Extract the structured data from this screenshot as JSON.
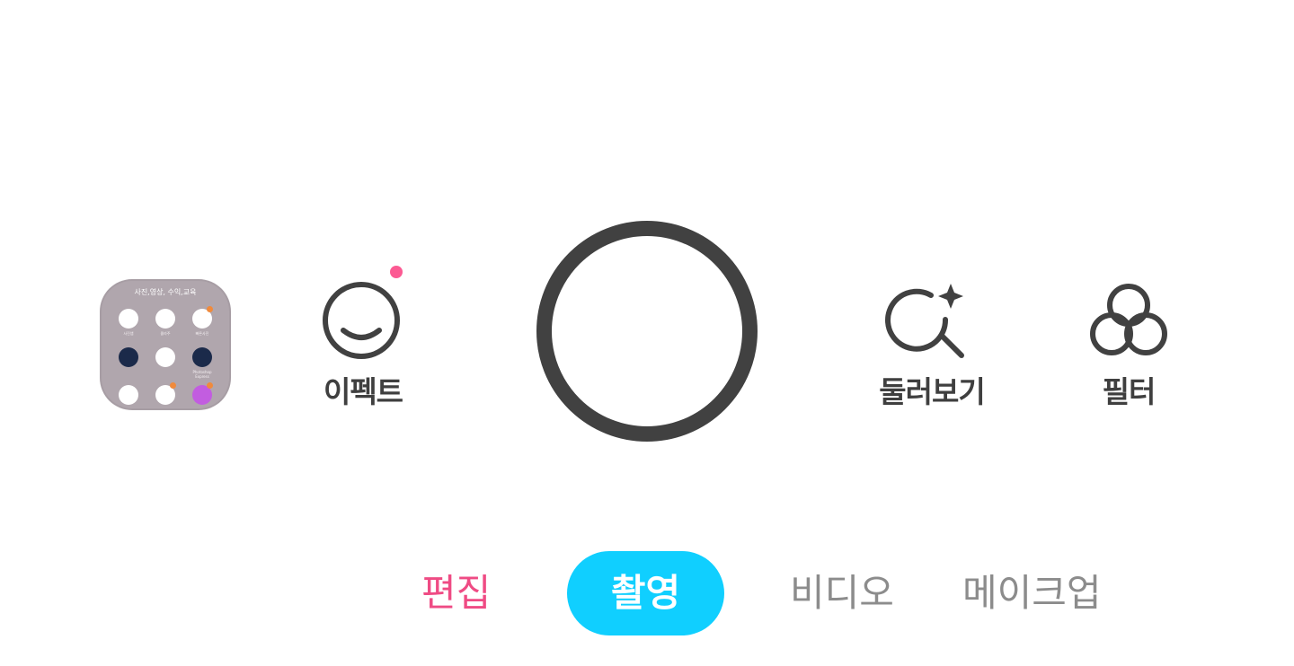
{
  "gallery": {
    "folder_title": "사진,영상, 수익,교육",
    "apps": [
      {
        "label": "사진앱",
        "icon": "photo-app-icon",
        "badge": false
      },
      {
        "label": "콜라주",
        "icon": "collage-app-icon",
        "badge": false
      },
      {
        "label": "빠른사진",
        "icon": "lightning-app-icon",
        "badge": true
      },
      {
        "label": "",
        "icon": "photo-editor-app-icon",
        "badge": false
      },
      {
        "label": "",
        "icon": "capcut-app-icon",
        "badge": false
      },
      {
        "label": "Photoshop Express",
        "icon": "photoshop-express-app-icon",
        "badge": false
      },
      {
        "label": "",
        "icon": "pencil-app-icon",
        "badge": false
      },
      {
        "label": "",
        "icon": "sticker-app-icon",
        "badge": true
      },
      {
        "label": "",
        "icon": "picsart-app-icon",
        "badge": true
      }
    ]
  },
  "tools": {
    "effect": {
      "label": "이펙트",
      "icon": "smiley-face-icon",
      "has_notification": true
    },
    "explore": {
      "label": "둘러보기",
      "icon": "sparkle-search-icon"
    },
    "filter": {
      "label": "필터",
      "icon": "three-circles-filter-icon"
    }
  },
  "modes": [
    {
      "label": "편집",
      "state": "highlight"
    },
    {
      "label": "촬영",
      "state": "active"
    },
    {
      "label": "비디오",
      "state": "inactive"
    },
    {
      "label": "메이크업",
      "state": "inactive"
    }
  ],
  "colors": {
    "accent_active": "#10cfff",
    "accent_edit": "#ef4b84",
    "notification_dot": "#fc5a93",
    "icon_dark": "#414141",
    "inactive_text": "#8c8c8c"
  }
}
